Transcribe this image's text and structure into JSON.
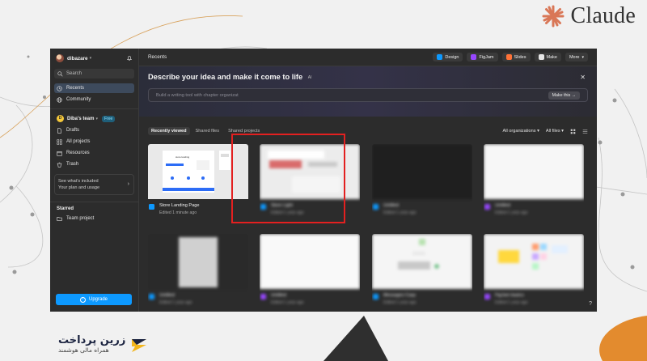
{
  "brand": {
    "name": "Claude",
    "color": "#d97757"
  },
  "watermark": {
    "name": "زرین پرداخت",
    "sub": "همراه مالی هوشمند"
  },
  "sidebar": {
    "user": "dibazare",
    "search_label": "Search",
    "nav": [
      {
        "label": "Recents",
        "icon": "clock-icon",
        "active": true
      },
      {
        "label": "Community",
        "icon": "globe-icon",
        "active": false
      }
    ],
    "team": {
      "name": "Diba's team",
      "badge": "Free"
    },
    "team_nav": [
      {
        "label": "Drafts",
        "icon": "file-icon"
      },
      {
        "label": "All projects",
        "icon": "grid-icon"
      },
      {
        "label": "Resources",
        "icon": "box-icon"
      },
      {
        "label": "Trash",
        "icon": "trash-icon"
      }
    ],
    "plan_card": {
      "line1": "See what's included",
      "line2": "Your plan and usage"
    },
    "starred_title": "Starred",
    "starred": [
      {
        "label": "Team project",
        "icon": "folder-icon"
      }
    ],
    "upgrade_label": "Upgrade"
  },
  "topbar": {
    "title": "Recents",
    "buttons": [
      {
        "label": "Design",
        "icon": "design-icon",
        "color": "#0d99ff"
      },
      {
        "label": "FigJam",
        "icon": "figjam-icon",
        "color": "#9747ff"
      },
      {
        "label": "Slides",
        "icon": "slides-icon",
        "color": "#ff7237"
      },
      {
        "label": "Make",
        "icon": "make-icon",
        "color": "#e6e6e6"
      },
      {
        "label": "More",
        "icon": "chevron-down-icon",
        "color": "#e6e6e6"
      }
    ]
  },
  "hero": {
    "title": "Describe your idea and make it come to life",
    "tag": "AI",
    "prompt_placeholder": "Build a writing tool with chapter organizat",
    "make_label": "Make this →"
  },
  "tabs": [
    {
      "label": "Recently viewed",
      "active": true
    },
    {
      "label": "Shared files",
      "active": false
    },
    {
      "label": "Shared projects",
      "active": false
    }
  ],
  "filters": {
    "org": "All organizations",
    "files": "All files"
  },
  "files": [
    {
      "name": "Store Landing Page",
      "edited": "Edited 1 minute ago",
      "type": "design",
      "blurred": false
    },
    {
      "name": "Store Light",
      "edited": "Edited 1 year ago",
      "type": "design",
      "blurred": true
    },
    {
      "name": "Untitled",
      "edited": "Edited 1 year ago",
      "type": "design",
      "blurred": true
    },
    {
      "name": "Untitled",
      "edited": "Edited 1 year ago",
      "type": "figjam",
      "blurred": true
    },
    {
      "name": "Untitled",
      "edited": "Edited 1 year ago",
      "type": "design",
      "blurred": true
    },
    {
      "name": "Untitled",
      "edited": "Edited 1 year ago",
      "type": "figjam",
      "blurred": true
    },
    {
      "name": "Messages Copy",
      "edited": "Edited 1 year ago",
      "type": "design",
      "blurred": true
    },
    {
      "name": "FigJam basics",
      "edited": "Edited 1 year ago",
      "type": "figjam",
      "blurred": true
    }
  ],
  "colors": {
    "app_bg": "#2c2c2c",
    "accent": "#0d99ff",
    "highlight": "#e32020"
  },
  "help_label": "?"
}
